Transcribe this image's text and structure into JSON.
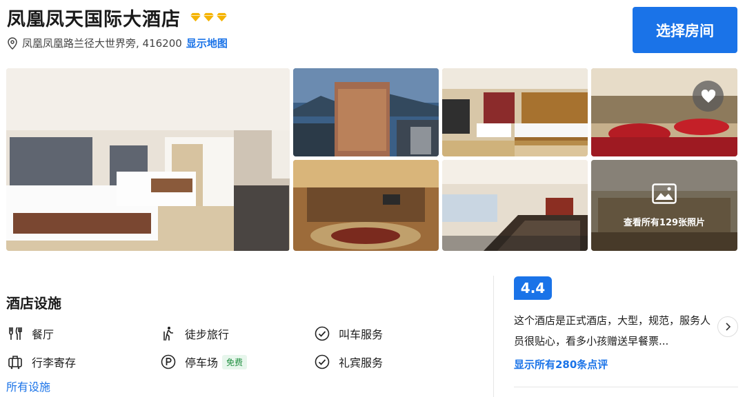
{
  "hotel": {
    "name": "凤凰凤天国际大酒店",
    "star_count": 3,
    "address": "凤凰凤凰路兰径大世界旁, 416200",
    "map_link": "显示地图",
    "cta_label": "选择房间"
  },
  "gallery": {
    "photo_count_label": "查看所有129张照片"
  },
  "facilities": {
    "title": "酒店设施",
    "items": [
      {
        "label": "餐厅",
        "icon": "restaurant-icon"
      },
      {
        "label": "徒步旅行",
        "icon": "hiking-icon"
      },
      {
        "label": "叫车服务",
        "icon": "check-circle-icon"
      },
      {
        "label": "行李寄存",
        "icon": "luggage-icon"
      },
      {
        "label": "停车场",
        "icon": "parking-icon",
        "badge": "免费"
      },
      {
        "label": "礼宾服务",
        "icon": "check-circle-icon"
      }
    ],
    "all_link": "所有设施"
  },
  "reviews": {
    "score": "4.4",
    "excerpt": "这个酒店是正式酒店，大型，规范，服务人员很贴心，看多小孩赠送早餐票...",
    "all_link": "显示所有280条点评"
  },
  "colors": {
    "accent": "#1a73e8",
    "star": "#f5b301",
    "free_badge_bg": "#e7f6ec",
    "free_badge_text": "#1e8e3e"
  }
}
